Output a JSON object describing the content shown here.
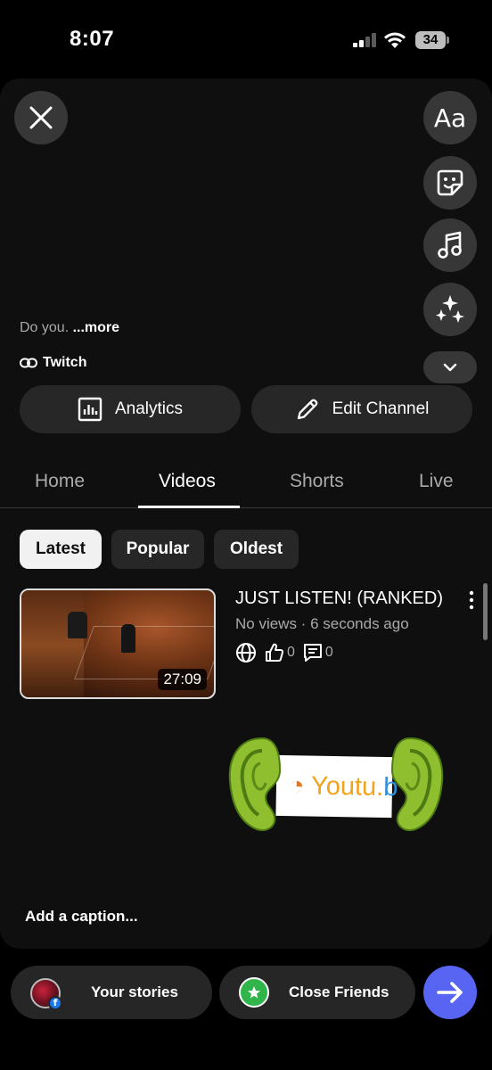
{
  "status_bar": {
    "time": "8:07",
    "battery": "34"
  },
  "story_tools": {
    "text_label": "Aa",
    "icons": [
      "close-icon",
      "text-tool-icon",
      "sticker-icon",
      "music-icon",
      "effects-sparkle-icon",
      "chevron-down-icon"
    ]
  },
  "channel": {
    "description_prefix": "Do you.",
    "more_label": "...more",
    "link_label": "Twitch",
    "analytics_label": "Analytics",
    "edit_label": "Edit Channel"
  },
  "tabs": [
    {
      "label": "Home",
      "active": false
    },
    {
      "label": "Videos",
      "active": true
    },
    {
      "label": "Shorts",
      "active": false
    },
    {
      "label": "Live",
      "active": false
    }
  ],
  "filters": [
    {
      "label": "Latest",
      "selected": true
    },
    {
      "label": "Popular",
      "selected": false
    },
    {
      "label": "Oldest",
      "selected": false
    }
  ],
  "video": {
    "title": "JUST LISTEN! (RANKED)",
    "meta": "No views · 6 seconds ago",
    "duration": "27:09",
    "likes": "0",
    "comments": "0"
  },
  "sticker": {
    "text_a": "Youtu.",
    "text_b": "b"
  },
  "caption_placeholder": "Add a caption...",
  "bottom_bar": {
    "your_stories": "Your stories",
    "close_friends": "Close Friends"
  },
  "colors": {
    "send_button": "#5865f2",
    "close_friends_badge": "#2fb54a",
    "facebook_badge": "#1877f2"
  }
}
